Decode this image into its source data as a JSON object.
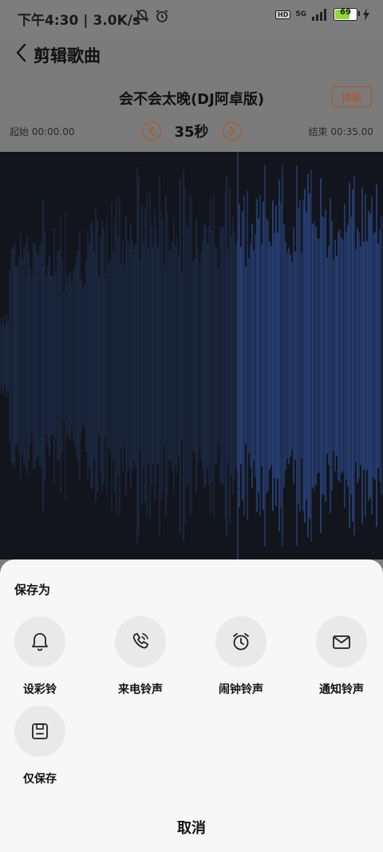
{
  "status_bar": {
    "time": "下午4:30",
    "speed": "3.0K/s",
    "hd": "HD",
    "network": "5G",
    "battery": "69",
    "battery_color": "#8fd93b"
  },
  "header": {
    "title": "剪辑歌曲",
    "song_title": "会不会太晚(DJ阿卓版)",
    "change_song": "换歌",
    "start_time": "起始 00:00.00",
    "duration": "35秒",
    "end_time": "结束 00:35.00",
    "accent_color": "#b5541d"
  },
  "waveform": {
    "background": "#12151c",
    "base_color": "#1e2d4a",
    "selected_color": "#2c4a8a"
  },
  "sheet": {
    "title": "保存为",
    "options": [
      {
        "label": "设彩铃",
        "icon": "bell-icon"
      },
      {
        "label": "来电铃声",
        "icon": "phone-ring-icon"
      },
      {
        "label": "闹钟铃声",
        "icon": "alarm-clock-icon"
      },
      {
        "label": "通知铃声",
        "icon": "mail-icon"
      },
      {
        "label": "仅保存",
        "icon": "save-icon"
      }
    ],
    "cancel": "取消"
  }
}
